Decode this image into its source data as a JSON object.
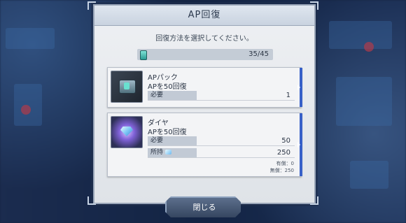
{
  "dialog": {
    "title": "AP回復",
    "instruction": "回復方法を選択してください。"
  },
  "ap": {
    "current": 35,
    "max": 45,
    "display": "35/45",
    "icon": "ap-canister-icon"
  },
  "options": [
    {
      "name": "APパック",
      "description": "APを50回復",
      "required_label": "必要",
      "required_value": "1",
      "icon": "ap-pack-icon"
    },
    {
      "name": "ダイヤ",
      "description": "APを50回復",
      "required_label": "必要",
      "required_value": "50",
      "owned_label": "所持",
      "owned_value": "250",
      "paid_text": "有償：0",
      "free_text": "無償：250",
      "icon": "diamond-icon"
    }
  ],
  "close_button": {
    "label": "閉じる"
  },
  "colors": {
    "accent": "#3760c8",
    "dialog_bg": "#eef0f3",
    "button_bg": "#33435d"
  }
}
